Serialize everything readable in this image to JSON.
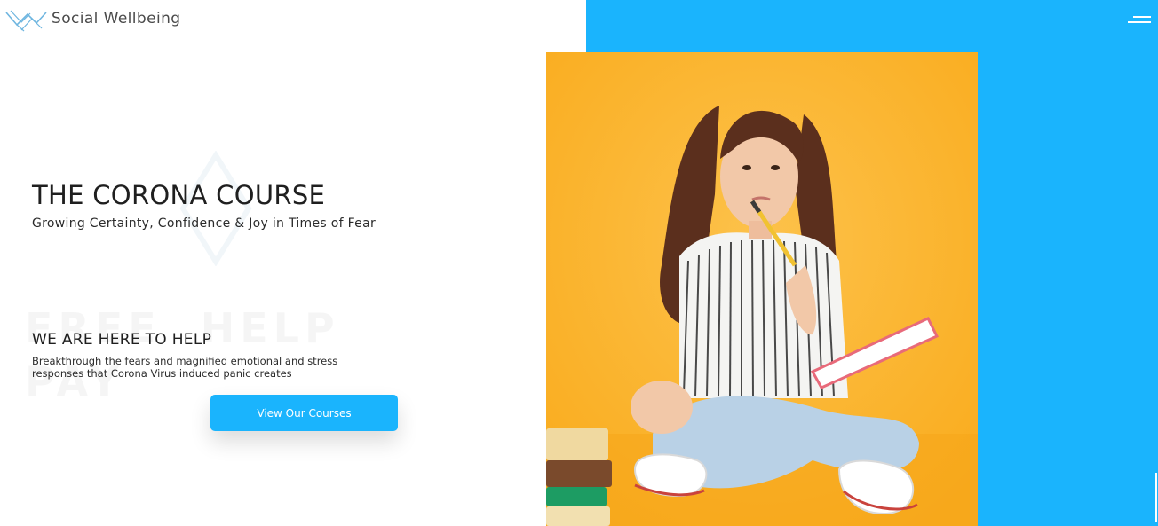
{
  "header": {
    "brand": "Social Wellbeing",
    "logo_icon": "social-wellbeing-logo",
    "menu_icon": "hamburger-menu-icon"
  },
  "hero": {
    "title": "THE CORONA COURSE",
    "subtitle": "Growing Certainty, Confidence & Joy in Times of Fear"
  },
  "help": {
    "heading": "WE ARE HERE TO HELP",
    "text": "Breakthrough the fears and magnified emotional and stress responses that Corona Virus induced panic creates",
    "cta_label": "View Our Courses"
  },
  "colors": {
    "accent": "#1ab4fd",
    "photo_background": "#fbb62d",
    "text_dark": "#1f1f1f"
  }
}
